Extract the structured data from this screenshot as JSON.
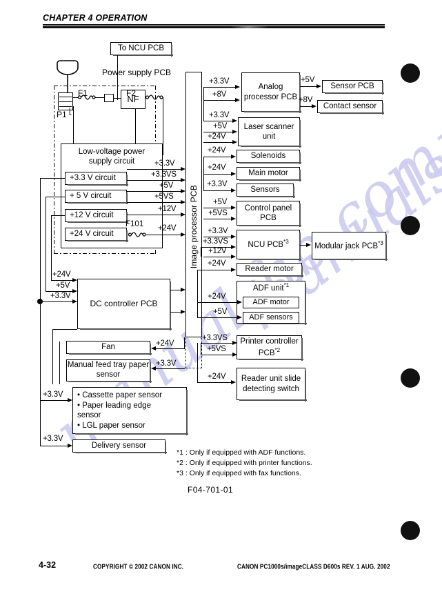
{
  "header": {
    "chapter": "CHAPTER 4 OPERATION"
  },
  "figure": {
    "number": "F04-701-01",
    "labels": {
      "to_ncu_pcb": "To NCU PCB",
      "power_supply_pcb": "Power supply PCB",
      "p1": "P1",
      "f1": "F1",
      "f2": "F2",
      "nf": "NF",
      "f101": "F101",
      "low_voltage": "Low-voltage power supply circuit",
      "image_processor_pcb": "Image processor PCB"
    },
    "lv_circuits": [
      {
        "name": "+3.3 V circuit"
      },
      {
        "name": "+ 5 V circuit"
      },
      {
        "name": "+12 V circuit"
      },
      {
        "name": "+24 V circuit"
      }
    ],
    "lv_outputs": [
      "+3.3V",
      "+3.3VS",
      "+5V",
      "+5VS",
      "+12V",
      "+24V"
    ],
    "dc_controller": {
      "name": "DC controller PCB",
      "inputs": [
        "+24V",
        "+5V",
        "+3.3V"
      ]
    },
    "left_loads": [
      {
        "name": "Fan",
        "voltage": "+24V"
      },
      {
        "name": "Manual feed tray paper sensor",
        "voltage": "+3.3V"
      },
      {
        "name": "• Cassette paper sensor\n• Paper leading edge\n   sensor\n• LGL paper sensor",
        "voltage": "+3.3V"
      },
      {
        "name": "Delivery sensor",
        "voltage": "+3.3V"
      }
    ],
    "right_loads": [
      {
        "name": "Analog processor PCB",
        "voltages": [
          "+3.3V",
          "+8V"
        ]
      },
      {
        "name": "Laser scanner unit",
        "voltages": [
          "+3.3V",
          "+5V",
          "+24V"
        ]
      },
      {
        "name": "Solenoids",
        "voltages": [
          "+24V"
        ]
      },
      {
        "name": "Main motor",
        "voltages": [
          "+24V"
        ]
      },
      {
        "name": "Sensors",
        "voltages": [
          "+3.3V"
        ]
      },
      {
        "name": "Control panel PCB",
        "voltages": [
          "+5V",
          "+5VS"
        ]
      },
      {
        "name": "NCU PCB",
        "note": "*3",
        "voltages": [
          "+3.3V",
          "+3.3VS",
          "+12V"
        ]
      },
      {
        "name": "Reader motor",
        "voltages": [
          "+24V"
        ]
      },
      {
        "name": "ADF unit",
        "note": "*1",
        "voltages": []
      },
      {
        "name": "ADF motor",
        "voltages": [
          "+24V"
        ]
      },
      {
        "name": "ADF sensors",
        "voltages": [
          "+5V"
        ]
      },
      {
        "name": "Printer controller PCB",
        "note": "*2",
        "voltages": [
          "+3.3VS",
          "+5VS"
        ]
      },
      {
        "name": "Reader unit slide detecting switch",
        "voltages": [
          "+24V"
        ]
      }
    ],
    "far_right_loads": [
      {
        "name": "Sensor PCB",
        "voltage": "+5V"
      },
      {
        "name": "Contact sensor",
        "voltage": "+8V"
      },
      {
        "name": "Modular jack PCB",
        "note": "*3",
        "voltage": ""
      }
    ],
    "footnotes": [
      "*1 :  Only if equipped with ADF functions.",
      "*2 :  Only if equipped with printer functions.",
      "*3 :  Only if equipped with fax functions."
    ]
  },
  "footer": {
    "page": "4-32",
    "copyright": "COPYRIGHT © 2002 CANON INC.",
    "model": "CANON PC1000s/imageCLASS D600s REV. 1 AUG. 2002"
  },
  "watermark": {
    "text": "manualslib.com"
  }
}
